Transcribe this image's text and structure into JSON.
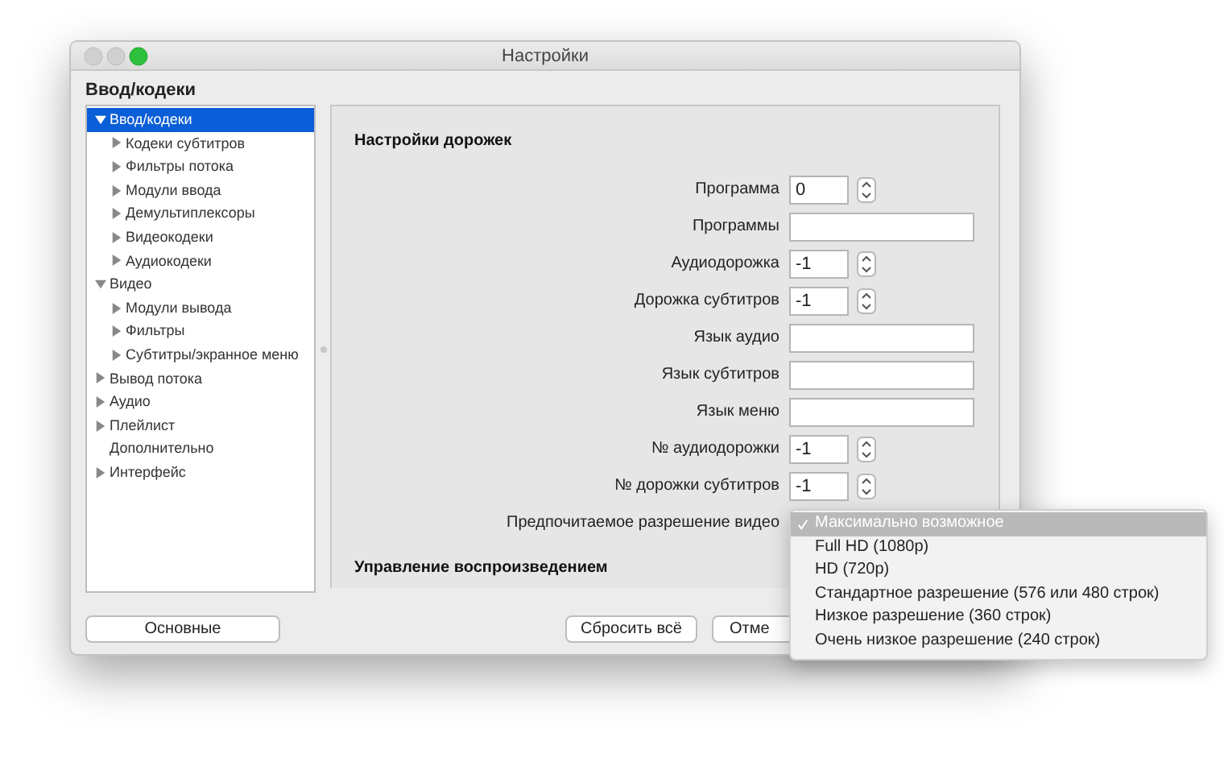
{
  "window": {
    "title": "Настройки"
  },
  "section_title": "Ввод/кодеки",
  "tree": [
    {
      "label": "Ввод/кодеки",
      "selected": true,
      "expanded": true,
      "children": [
        {
          "label": "Кодеки субтитров",
          "selected": false,
          "expanded": false
        },
        {
          "label": "Фильтры потока",
          "selected": false,
          "expanded": false
        },
        {
          "label": "Модули ввода",
          "selected": false,
          "expanded": false
        },
        {
          "label": "Демультиплексоры",
          "selected": false,
          "expanded": false
        },
        {
          "label": "Видеокодеки",
          "selected": false,
          "expanded": false
        },
        {
          "label": "Аудиокодеки",
          "selected": false,
          "expanded": false
        }
      ]
    },
    {
      "label": "Видео",
      "selected": false,
      "expanded": true,
      "children": [
        {
          "label": "Модули вывода",
          "selected": false,
          "expanded": false
        },
        {
          "label": "Фильтры",
          "selected": false,
          "expanded": false
        },
        {
          "label": "Субтитры/экранное меню",
          "selected": false,
          "expanded": false
        }
      ]
    },
    {
      "label": "Вывод потока",
      "selected": false,
      "expanded": false
    },
    {
      "label": "Аудио",
      "selected": false,
      "expanded": false
    },
    {
      "label": "Плейлист",
      "selected": false,
      "expanded": false
    },
    {
      "label": "Дополнительно",
      "selected": false
    },
    {
      "label": "Интерфейс",
      "selected": false,
      "expanded": false
    }
  ],
  "panel": {
    "heading": "Настройки дорожек",
    "rows": [
      {
        "kind": "spin",
        "label": "Программа",
        "value": "0"
      },
      {
        "kind": "text",
        "label": "Программы"
      },
      {
        "kind": "spin",
        "label": "Аудиодорожка",
        "value": "-1"
      },
      {
        "kind": "spin",
        "label": "Дорожка субтитров",
        "value": "-1"
      },
      {
        "kind": "text",
        "label": "Язык аудио"
      },
      {
        "kind": "text",
        "label": "Язык субтитров"
      },
      {
        "kind": "text",
        "label": "Язык меню"
      },
      {
        "kind": "spin",
        "label": "№ аудиодорожки",
        "value": "-1"
      },
      {
        "kind": "spin",
        "label": "№ дорожки субтитров",
        "value": "-1"
      },
      {
        "kind": "select",
        "label": "Предпочитаемое разрешение видео"
      }
    ],
    "next_heading": "Управление воспроизведением"
  },
  "buttons": {
    "basic": "Основные",
    "reset": "Сбросить всё",
    "cancel": "Отме"
  },
  "dropdown": [
    {
      "label": "Максимально возможное",
      "selected": true
    },
    {
      "label": "Full HD (1080p)",
      "selected": false
    },
    {
      "label": "HD (720p)",
      "selected": false
    },
    {
      "label": "Стандартное разрешение (576 или 480 строк)",
      "selected": false
    },
    {
      "label": "Низкое разрешение (360 строк)",
      "selected": false
    },
    {
      "label": "Очень низкое разрешение (240 строк)",
      "selected": false
    }
  ]
}
